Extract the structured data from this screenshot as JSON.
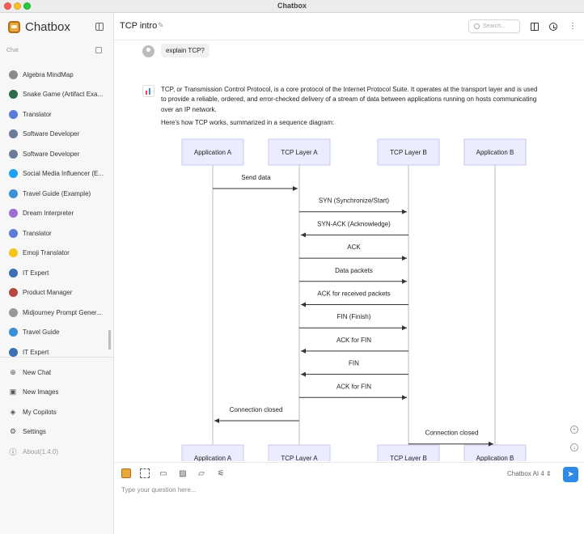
{
  "window": {
    "title": "Chatbox"
  },
  "sidebar": {
    "brand": "Chatbox",
    "section_label": "Chat",
    "chats": [
      {
        "label": "Algebra MindMap",
        "color": "#8a8a8a"
      },
      {
        "label": "Snake Game (Artifact Exa...",
        "color": "#2d6b4f"
      },
      {
        "label": "Translator",
        "color": "#5a7bd8"
      },
      {
        "label": "Software Developer",
        "color": "#6b7b99"
      },
      {
        "label": "Software Developer",
        "color": "#6b7b99"
      },
      {
        "label": "Social Media Influencer (E...",
        "color": "#1da1f2"
      },
      {
        "label": "Travel Guide (Example)",
        "color": "#3b8fd9"
      },
      {
        "label": "Dream Interpreter",
        "color": "#9b6fd1"
      },
      {
        "label": "Translator",
        "color": "#5a7bd8"
      },
      {
        "label": "Emoji Translator",
        "color": "#f5c518"
      },
      {
        "label": "IT Expert",
        "color": "#3d6fb5"
      },
      {
        "label": "Product Manager",
        "color": "#b5473d"
      },
      {
        "label": "Midjourney Prompt Gener...",
        "color": "#999999"
      },
      {
        "label": "Travel Guide",
        "color": "#3b8fd9"
      },
      {
        "label": "IT Expert",
        "color": "#3d6fb5"
      }
    ],
    "menu": [
      {
        "label": "New Chat",
        "icon": "⊕",
        "name": "new-chat-button",
        "dim": false
      },
      {
        "label": "New Images",
        "icon": "▣",
        "name": "new-images-button",
        "dim": false
      },
      {
        "label": "My Copilots",
        "icon": "◈",
        "name": "my-copilots-button",
        "dim": false
      },
      {
        "label": "Settings",
        "icon": "⚙",
        "name": "settings-button",
        "dim": false
      },
      {
        "label": "About(1.4.0)",
        "icon": "ⓘ",
        "name": "about-button",
        "dim": true
      }
    ]
  },
  "header": {
    "title": "TCP intro",
    "search_placeholder": "Search..."
  },
  "conversation": {
    "user_message": "explain TCP?",
    "ai_paragraph_1": "TCP, or Transmission Control Protocol, is a core protocol of the Internet Protocol Suite. It operates at the transport layer and is used to provide a reliable, ordered, and error-checked delivery of a stream of data between applications running on hosts communicating over an IP network.",
    "ai_paragraph_2": "Here's how TCP works, summarized in a sequence diagram:"
  },
  "diagram": {
    "participants": [
      "Application A",
      "TCP Layer A",
      "TCP Layer B",
      "Application B"
    ],
    "messages": [
      {
        "from": 0,
        "to": 1,
        "label": "Send data"
      },
      {
        "from": 1,
        "to": 2,
        "label": "SYN (Synchronize/Start)"
      },
      {
        "from": 2,
        "to": 1,
        "label": "SYN-ACK (Acknowledge)"
      },
      {
        "from": 1,
        "to": 2,
        "label": "ACK"
      },
      {
        "from": 1,
        "to": 2,
        "label": "Data packets"
      },
      {
        "from": 2,
        "to": 1,
        "label": "ACK for received packets"
      },
      {
        "from": 1,
        "to": 2,
        "label": "FIN (Finish)"
      },
      {
        "from": 2,
        "to": 1,
        "label": "ACK for FIN"
      },
      {
        "from": 2,
        "to": 1,
        "label": "FIN"
      },
      {
        "from": 1,
        "to": 2,
        "label": "ACK for FIN"
      },
      {
        "from": 1,
        "to": 0,
        "label": "Connection closed"
      },
      {
        "from": 2,
        "to": 3,
        "label": "Connection closed"
      }
    ],
    "box_color": "#ececff",
    "box_border": "#c9c9f0"
  },
  "input": {
    "placeholder": "Type your question here...",
    "model": "Chatbox AI 4 ⇕"
  }
}
